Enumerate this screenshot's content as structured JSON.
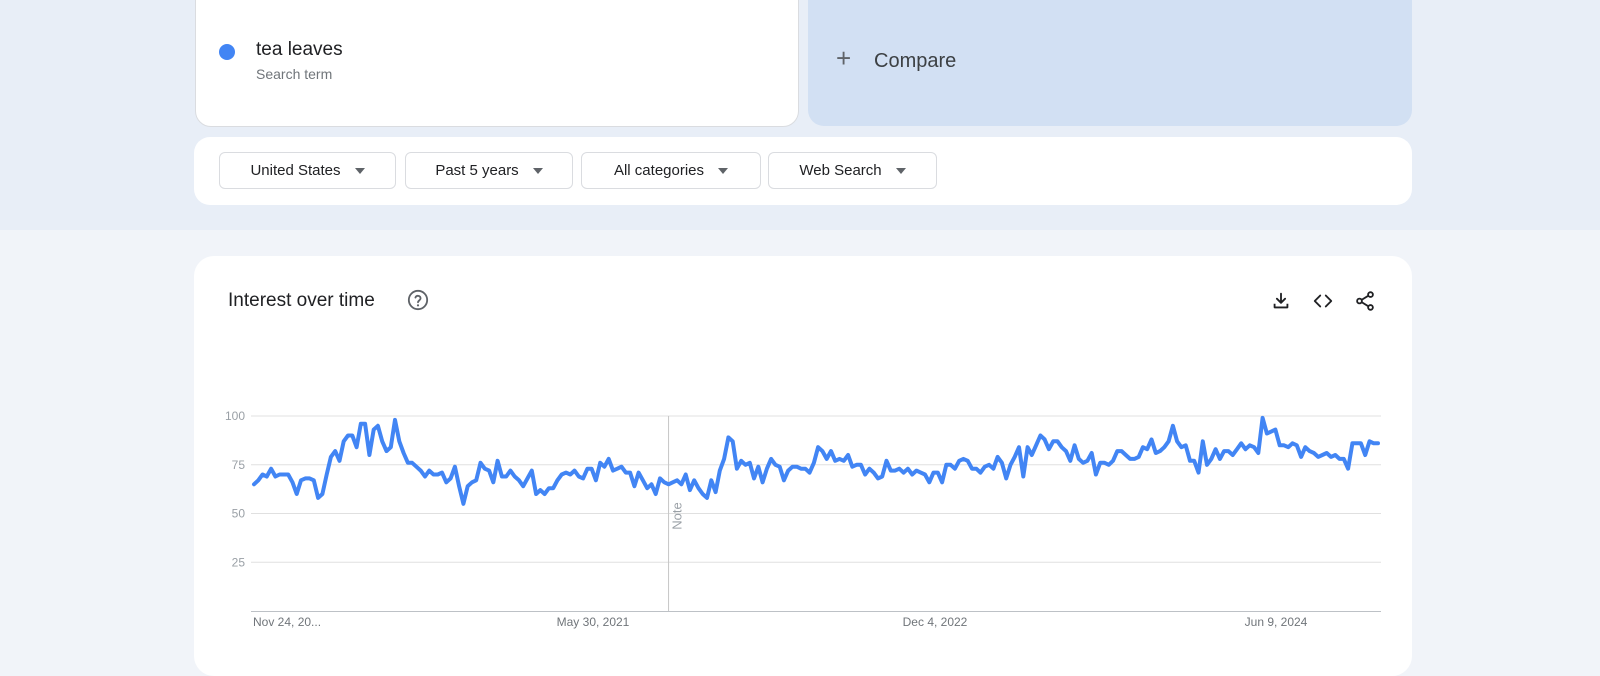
{
  "search_term": {
    "name": "tea leaves",
    "subtitle": "Search term",
    "color": "#4285f4"
  },
  "compare": {
    "plus": "+",
    "label": "Compare"
  },
  "filters": {
    "region": "United States",
    "time_range": "Past 5 years",
    "category": "All categories",
    "search_type": "Web Search"
  },
  "chart_section": {
    "title": "Interest over time",
    "help_icon": "help-circle-icon",
    "download_icon": "download-icon",
    "embed_icon": "code-icon",
    "share_icon": "share-icon",
    "note_label": "Note"
  },
  "chart_data": {
    "type": "line",
    "title": "Interest over time",
    "ylim": [
      0,
      100
    ],
    "yticks": [
      25,
      50,
      75,
      100
    ],
    "x_tick_labels": [
      "Nov 24, 20...",
      "May 30, 2021",
      "Dec 4, 2022",
      "Jun 9, 2024"
    ],
    "grid": true,
    "note_week_index": 97,
    "series": [
      {
        "name": "tea leaves",
        "color": "#4285f4",
        "values": [
          65,
          67,
          70,
          69,
          73,
          69,
          70,
          70,
          70,
          66,
          60,
          67,
          68,
          68,
          67,
          58,
          60,
          70,
          79,
          82,
          77,
          87,
          90,
          90,
          84,
          96,
          96,
          80,
          93,
          95,
          87,
          82,
          84,
          98,
          87,
          81,
          76,
          76,
          74,
          72,
          69,
          72,
          70,
          70,
          71,
          66,
          68,
          74,
          64,
          55,
          64,
          66,
          67,
          76,
          73,
          72,
          66,
          77,
          69,
          69,
          72,
          69,
          67,
          64,
          68,
          72,
          60,
          62,
          60,
          63,
          63,
          67,
          70,
          71,
          70,
          72,
          69,
          68,
          73,
          73,
          67,
          76,
          74,
          78,
          72,
          73,
          74,
          71,
          71,
          64,
          71,
          67,
          63,
          65,
          60,
          68,
          66,
          65,
          66,
          67,
          65,
          70,
          62,
          67,
          63,
          60,
          58,
          67,
          61,
          72,
          78,
          89,
          87,
          73,
          77,
          75,
          76,
          68,
          74,
          66,
          73,
          78,
          75,
          74,
          67,
          72,
          74,
          74,
          73,
          73,
          71,
          76,
          84,
          82,
          78,
          82,
          77,
          78,
          77,
          80,
          74,
          75,
          75,
          70,
          73,
          71,
          68,
          69,
          77,
          72,
          72,
          73,
          71,
          73,
          70,
          72,
          71,
          70,
          66,
          71,
          71,
          66,
          75,
          75,
          73,
          77,
          78,
          77,
          73,
          73,
          71,
          74,
          75,
          73,
          79,
          76,
          68,
          75,
          79,
          84,
          69,
          84,
          80,
          85,
          90,
          88,
          83,
          87,
          87,
          84,
          82,
          77,
          85,
          78,
          76,
          77,
          81,
          70,
          76,
          76,
          75,
          77,
          82,
          82,
          80,
          78,
          78,
          79,
          84,
          83,
          88,
          81,
          82,
          84,
          87,
          95,
          87,
          84,
          85,
          77,
          77,
          71,
          87,
          75,
          78,
          83,
          78,
          82,
          82,
          80,
          83,
          86,
          83,
          85,
          84,
          81,
          99,
          91,
          92,
          93,
          85,
          85,
          84,
          86,
          85,
          79,
          84,
          82,
          81,
          79,
          80,
          81,
          79,
          80,
          78,
          78,
          73,
          86,
          86,
          86,
          80,
          87,
          86,
          86
        ]
      }
    ]
  }
}
